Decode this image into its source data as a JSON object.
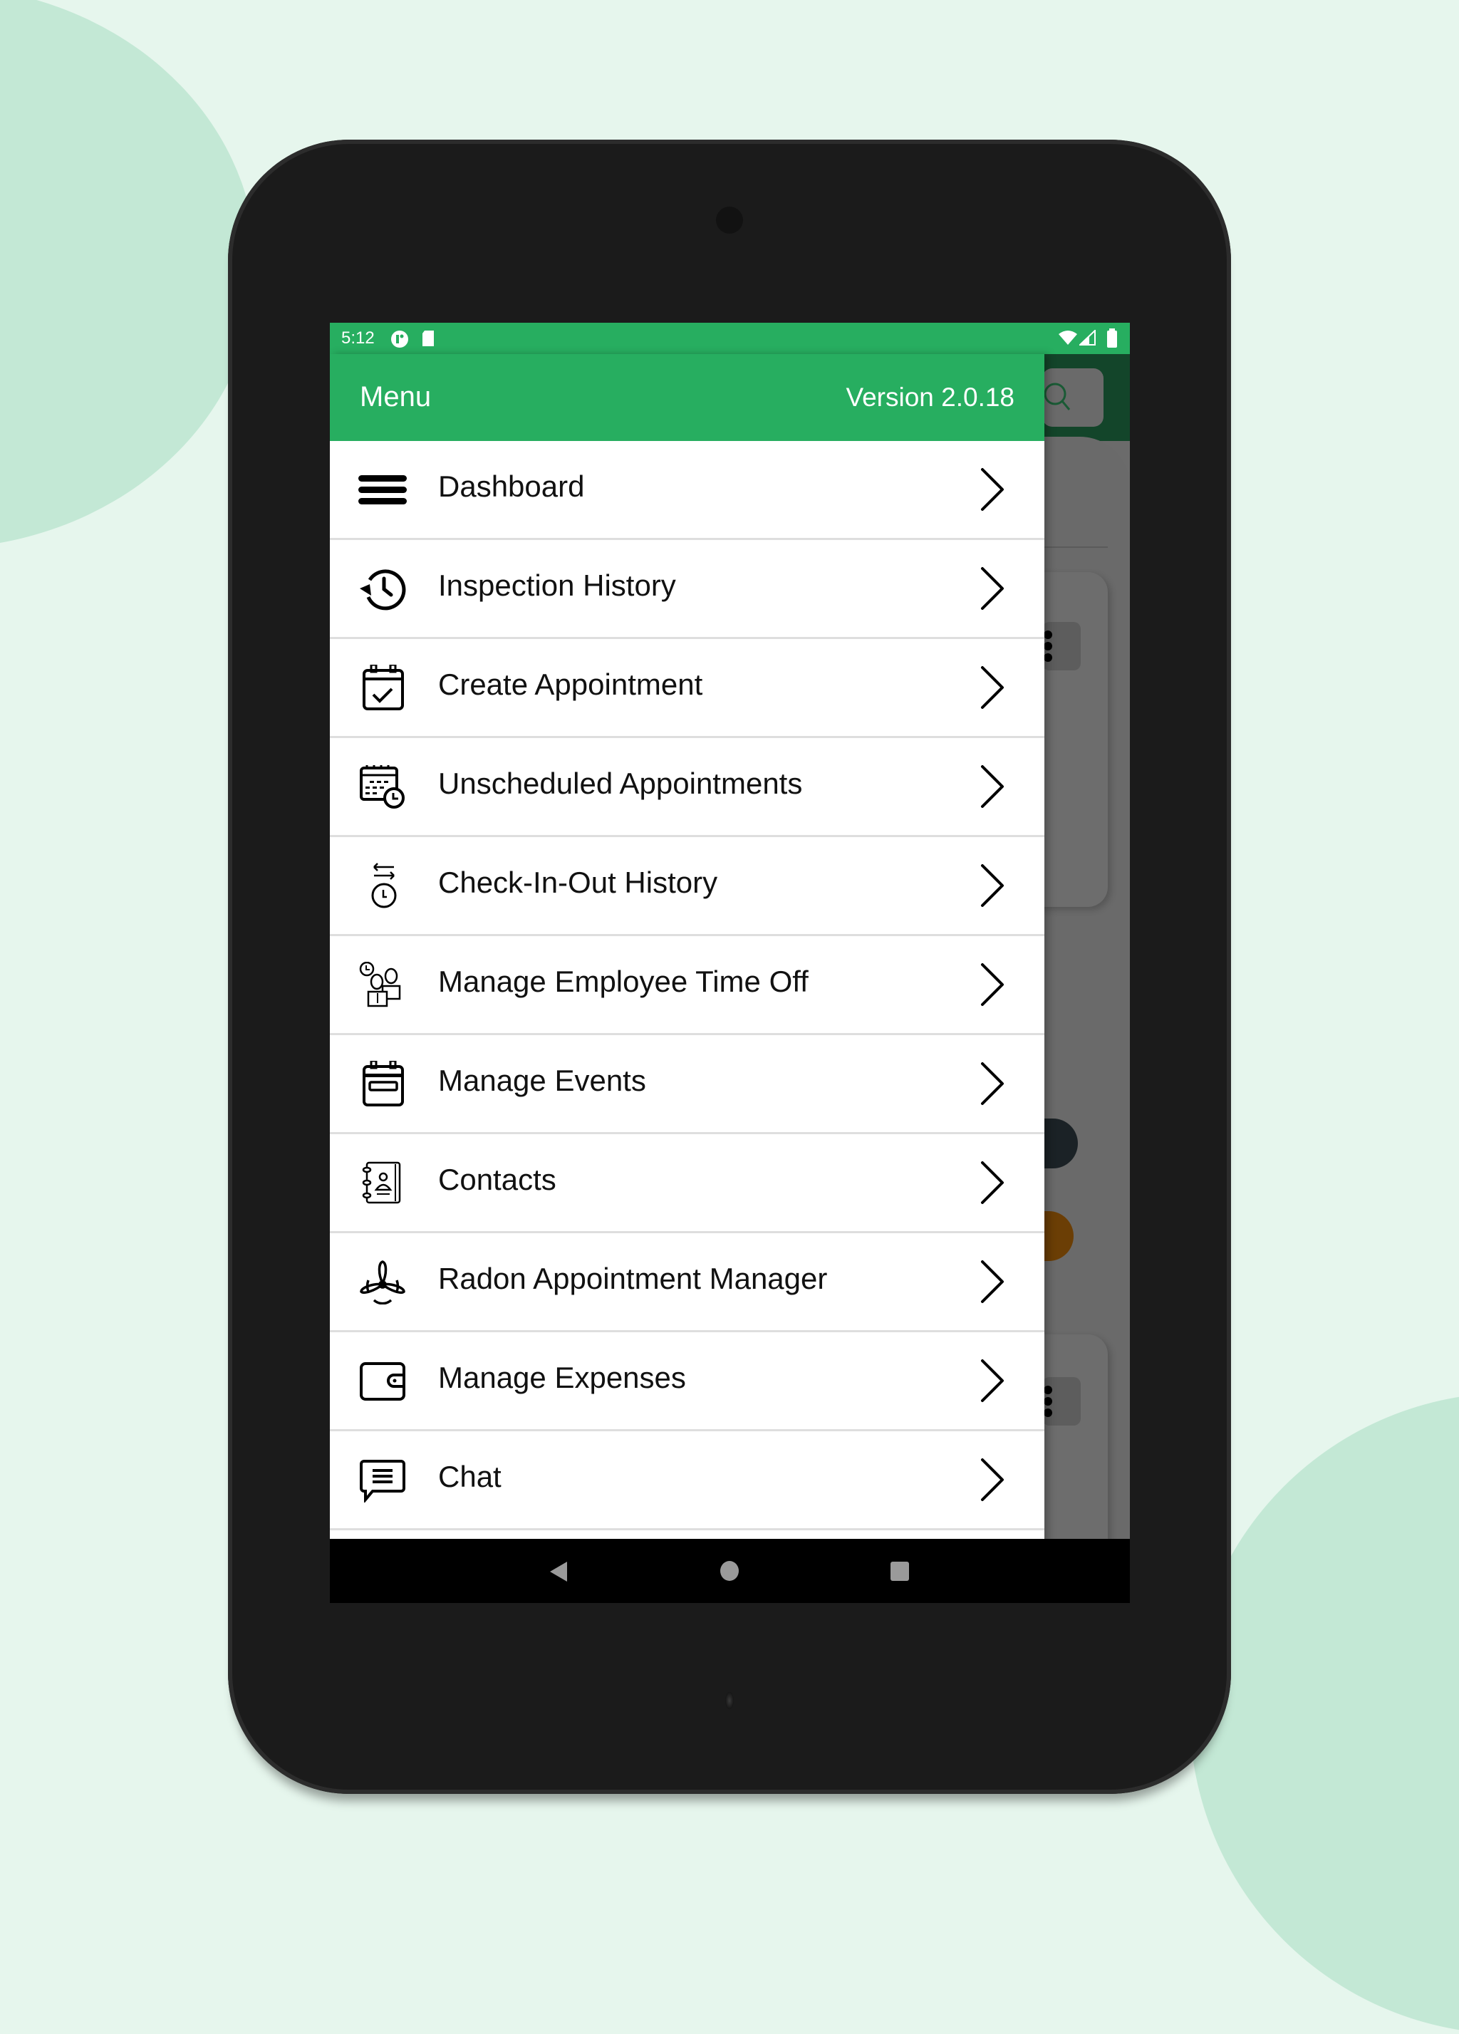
{
  "status_bar": {
    "time": "5:12",
    "left_icons": [
      "media-notification-icon",
      "sd-card-icon"
    ],
    "right_icons": [
      "wifi-icon",
      "signal-icon",
      "battery-icon"
    ]
  },
  "drawer": {
    "title": "Menu",
    "version": "Version 2.0.18",
    "items": [
      {
        "label": "Dashboard",
        "icon": "hamburger-icon"
      },
      {
        "label": "Inspection History",
        "icon": "history-icon"
      },
      {
        "label": "Create Appointment",
        "icon": "calendar-check-icon"
      },
      {
        "label": "Unscheduled Appointments",
        "icon": "calendar-clock-icon"
      },
      {
        "label": "Check-In-Out History",
        "icon": "timer-swap-icon"
      },
      {
        "label": "Manage Employee Time Off",
        "icon": "employees-clock-icon"
      },
      {
        "label": "Manage Events",
        "icon": "calendar-event-icon"
      },
      {
        "label": "Contacts",
        "icon": "address-book-icon"
      },
      {
        "label": "Radon Appointment Manager",
        "icon": "fan-icon"
      },
      {
        "label": "Manage Expenses",
        "icon": "wallet-icon"
      },
      {
        "label": "Chat",
        "icon": "chat-icon"
      }
    ]
  },
  "navigation_bar": {
    "buttons": [
      "back",
      "home",
      "recents"
    ]
  },
  "colors": {
    "brand_green": "#27ae60",
    "page_background": "#e6f6ed",
    "background_blob": "#c3e8d5"
  }
}
